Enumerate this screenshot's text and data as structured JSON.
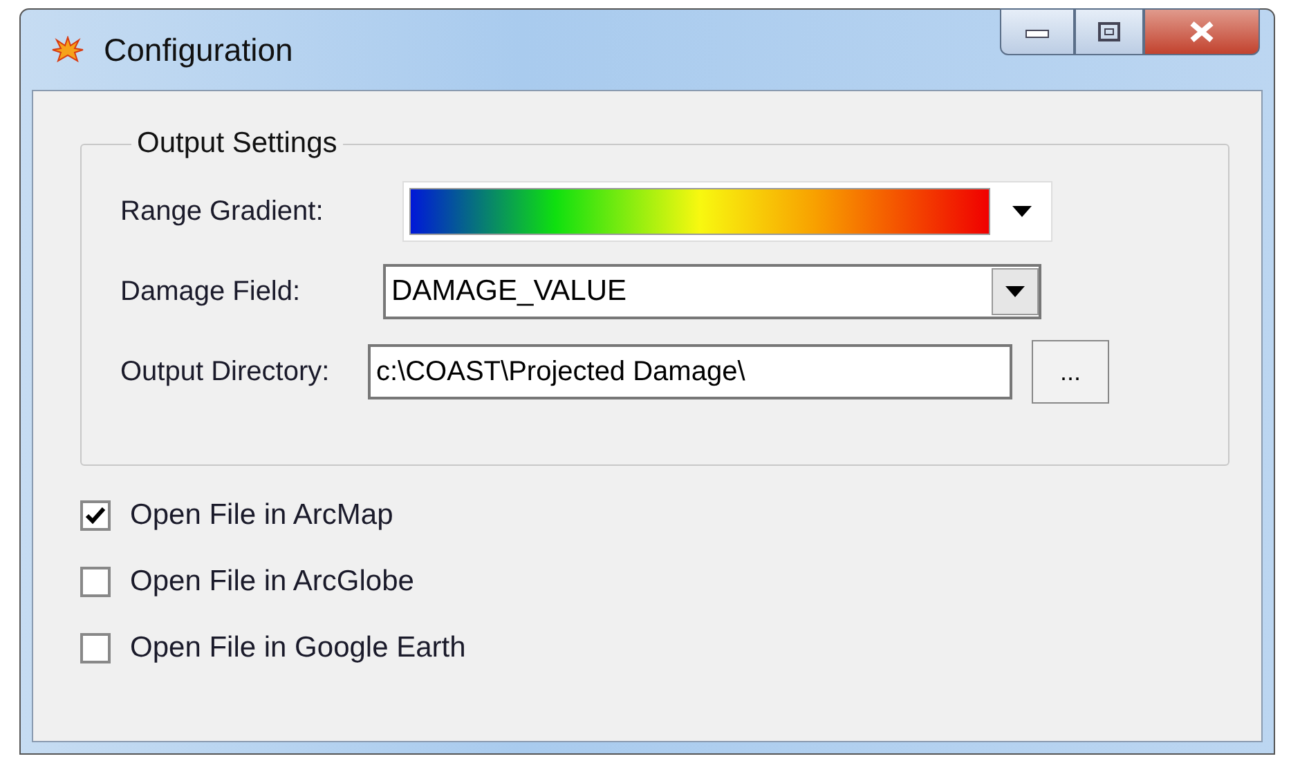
{
  "window": {
    "title": "Configuration"
  },
  "output_settings": {
    "title": "Output Settings",
    "range_gradient": {
      "label": "Range Gradient:"
    },
    "damage_field": {
      "label": "Damage Field:",
      "value": "DAMAGE_VALUE"
    },
    "output_directory": {
      "label": "Output Directory:",
      "value": "c:\\COAST\\Projected Damage\\",
      "browse": "..."
    }
  },
  "options": [
    {
      "label": "Open File in ArcMap",
      "checked": true
    },
    {
      "label": "Open File in ArcGlobe",
      "checked": false
    },
    {
      "label": "Open File in Google Earth",
      "checked": false
    }
  ]
}
